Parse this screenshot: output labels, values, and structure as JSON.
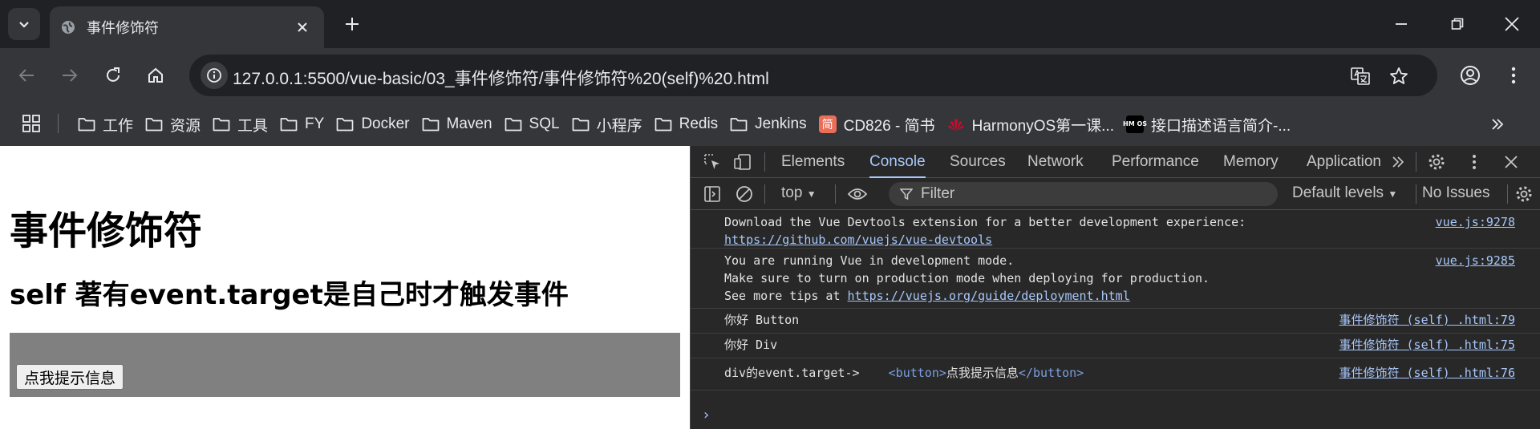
{
  "browser": {
    "tab": {
      "title": "事件修饰符"
    },
    "address": {
      "url": "127.0.0.1:5500/vue-basic/03_事件修饰符/事件修饰符%20(self)%20.html"
    },
    "bookmarks": [
      {
        "label": "工作",
        "icon": "folder-icon"
      },
      {
        "label": "资源",
        "icon": "folder-icon"
      },
      {
        "label": "工具",
        "icon": "folder-icon"
      },
      {
        "label": "FY",
        "icon": "folder-icon"
      },
      {
        "label": "Docker",
        "icon": "folder-icon"
      },
      {
        "label": "Maven",
        "icon": "folder-icon"
      },
      {
        "label": "SQL",
        "icon": "folder-icon"
      },
      {
        "label": "小程序",
        "icon": "folder-icon"
      },
      {
        "label": "Redis",
        "icon": "folder-icon"
      },
      {
        "label": "Jenkins",
        "icon": "folder-icon"
      },
      {
        "label": "CD826 - 简书",
        "icon": "jianshu-icon"
      },
      {
        "label": "HarmonyOS第一课...",
        "icon": "huawei-icon"
      },
      {
        "label": "接口描述语言简介-...",
        "icon": "hmos-icon"
      }
    ],
    "jianshu_glyph": "简",
    "hmos_glyph": "HM OS"
  },
  "page": {
    "heading": "事件修饰符",
    "subheading": "self 著有event.target是自己时才触发事件",
    "button_label": "点我提示信息"
  },
  "devtools": {
    "tabs": [
      "Elements",
      "Console",
      "Sources",
      "Network",
      "Performance",
      "Memory",
      "Application"
    ],
    "active_tab": "Console",
    "context": "top",
    "filter_placeholder": "Filter",
    "levels": "Default levels",
    "issues": "No Issues",
    "messages": [
      {
        "lines": [
          "Download the Vue Devtools extension for a better development experience:"
        ],
        "link": "https://github.com/vuejs/vue-devtools",
        "source": "vue.js:9278"
      },
      {
        "lines": [
          "You are running Vue in development mode.",
          "Make sure to turn on production mode when deploying for production."
        ],
        "link_prefix": "See more tips at ",
        "link": "https://vuejs.org/guide/deployment.html",
        "source": "vue.js:9285"
      },
      {
        "text": "你好 Button",
        "source": "事件修饰符 (self) .html:79"
      },
      {
        "text": "你好 Div",
        "source": "事件修饰符 (self) .html:75"
      },
      {
        "prefix": "div的event.target->",
        "tag_open": "<button>",
        "inner": "点我提示信息",
        "tag_close": "</button>",
        "source": "事件修饰符 (self) .html:76"
      }
    ],
    "prompt": "›"
  },
  "colors": {
    "accent": "#a8c7fa",
    "tab_bg": "#35363a",
    "frame_bg": "#202124",
    "devtools_bg": "#282828",
    "gray_div": "#808080"
  }
}
